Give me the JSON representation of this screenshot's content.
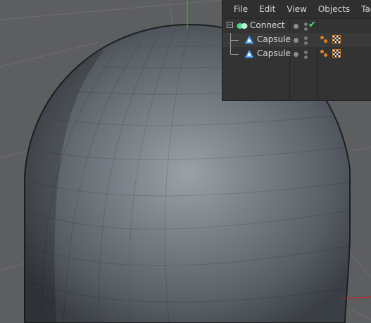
{
  "menu": {
    "file": "File",
    "edit": "Edit",
    "view": "View",
    "objects": "Objects",
    "tags": "Tags"
  },
  "objects": [
    {
      "name": "Connect",
      "icon": "connect-icon",
      "visible_check": true
    },
    {
      "name": "Capsule",
      "icon": "capsule-icon",
      "tags": [
        "phong-tag-icon",
        "material-tag-icon"
      ]
    },
    {
      "name": "Capsule",
      "icon": "capsule-icon",
      "tags": [
        "phong-tag-icon",
        "material-tag-icon"
      ]
    }
  ],
  "colors": {
    "viewport_bg": "#5d5e60",
    "panel_bg": "#333333",
    "check": "#4fe07a",
    "axis_y": "#22cc22",
    "axis_x": "#cc2222",
    "capsule_highlight": "#9aa1a8"
  }
}
